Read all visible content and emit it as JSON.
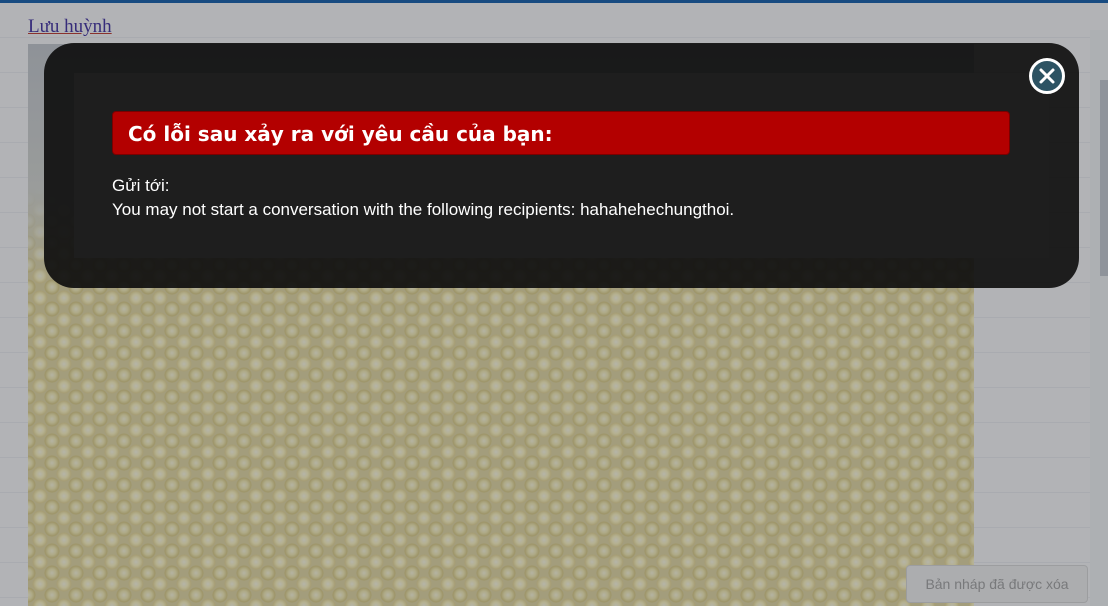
{
  "page": {
    "link_text": "Lưu huỳnh"
  },
  "modal": {
    "header": "Có lỗi sau xảy ra với yêu cầu của bạn:",
    "label": "Gửi tới:",
    "message": "You may not start a conversation with the following recipients: hahahehechungthoi.",
    "close_icon": "close-icon"
  },
  "draft": {
    "status": "Bản nháp đã được xóa"
  },
  "colors": {
    "header_red": "#b30000",
    "close_button": "#2d5363",
    "top_border": "#1f66b0"
  }
}
